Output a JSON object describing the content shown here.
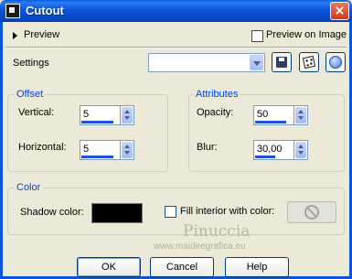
{
  "window": {
    "title": "Cutout",
    "close_glyph": "×"
  },
  "top": {
    "preview_label": "Preview",
    "preview_on_image_label": "Preview on Image"
  },
  "settings": {
    "label": "Settings",
    "combo_value": "",
    "icons": [
      "save-floppy-icon",
      "randomize-dice-icon",
      "reset-icon"
    ]
  },
  "offset": {
    "legend": "Offset",
    "vertical_label": "Vertical:",
    "vertical_value": "5",
    "horizontal_label": "Horizontal:",
    "horizontal_value": "5"
  },
  "attributes": {
    "legend": "Attributes",
    "opacity_label": "Opacity:",
    "opacity_value": "50",
    "blur_label": "Blur:",
    "blur_value": "30,00"
  },
  "color": {
    "legend": "Color",
    "shadow_label": "Shadow color:",
    "shadow_color": "#000000",
    "fill_label": "Fill interior with color:"
  },
  "watermark": {
    "name": "Pinuccia",
    "url": "www.maidiregrafica.eu"
  },
  "buttons": {
    "ok": "OK",
    "cancel": "Cancel",
    "help": "Help"
  },
  "colors": {
    "accent": "#0046d5",
    "title_bar": "#0b55d8",
    "dialog_bg": "#ece9d8"
  }
}
